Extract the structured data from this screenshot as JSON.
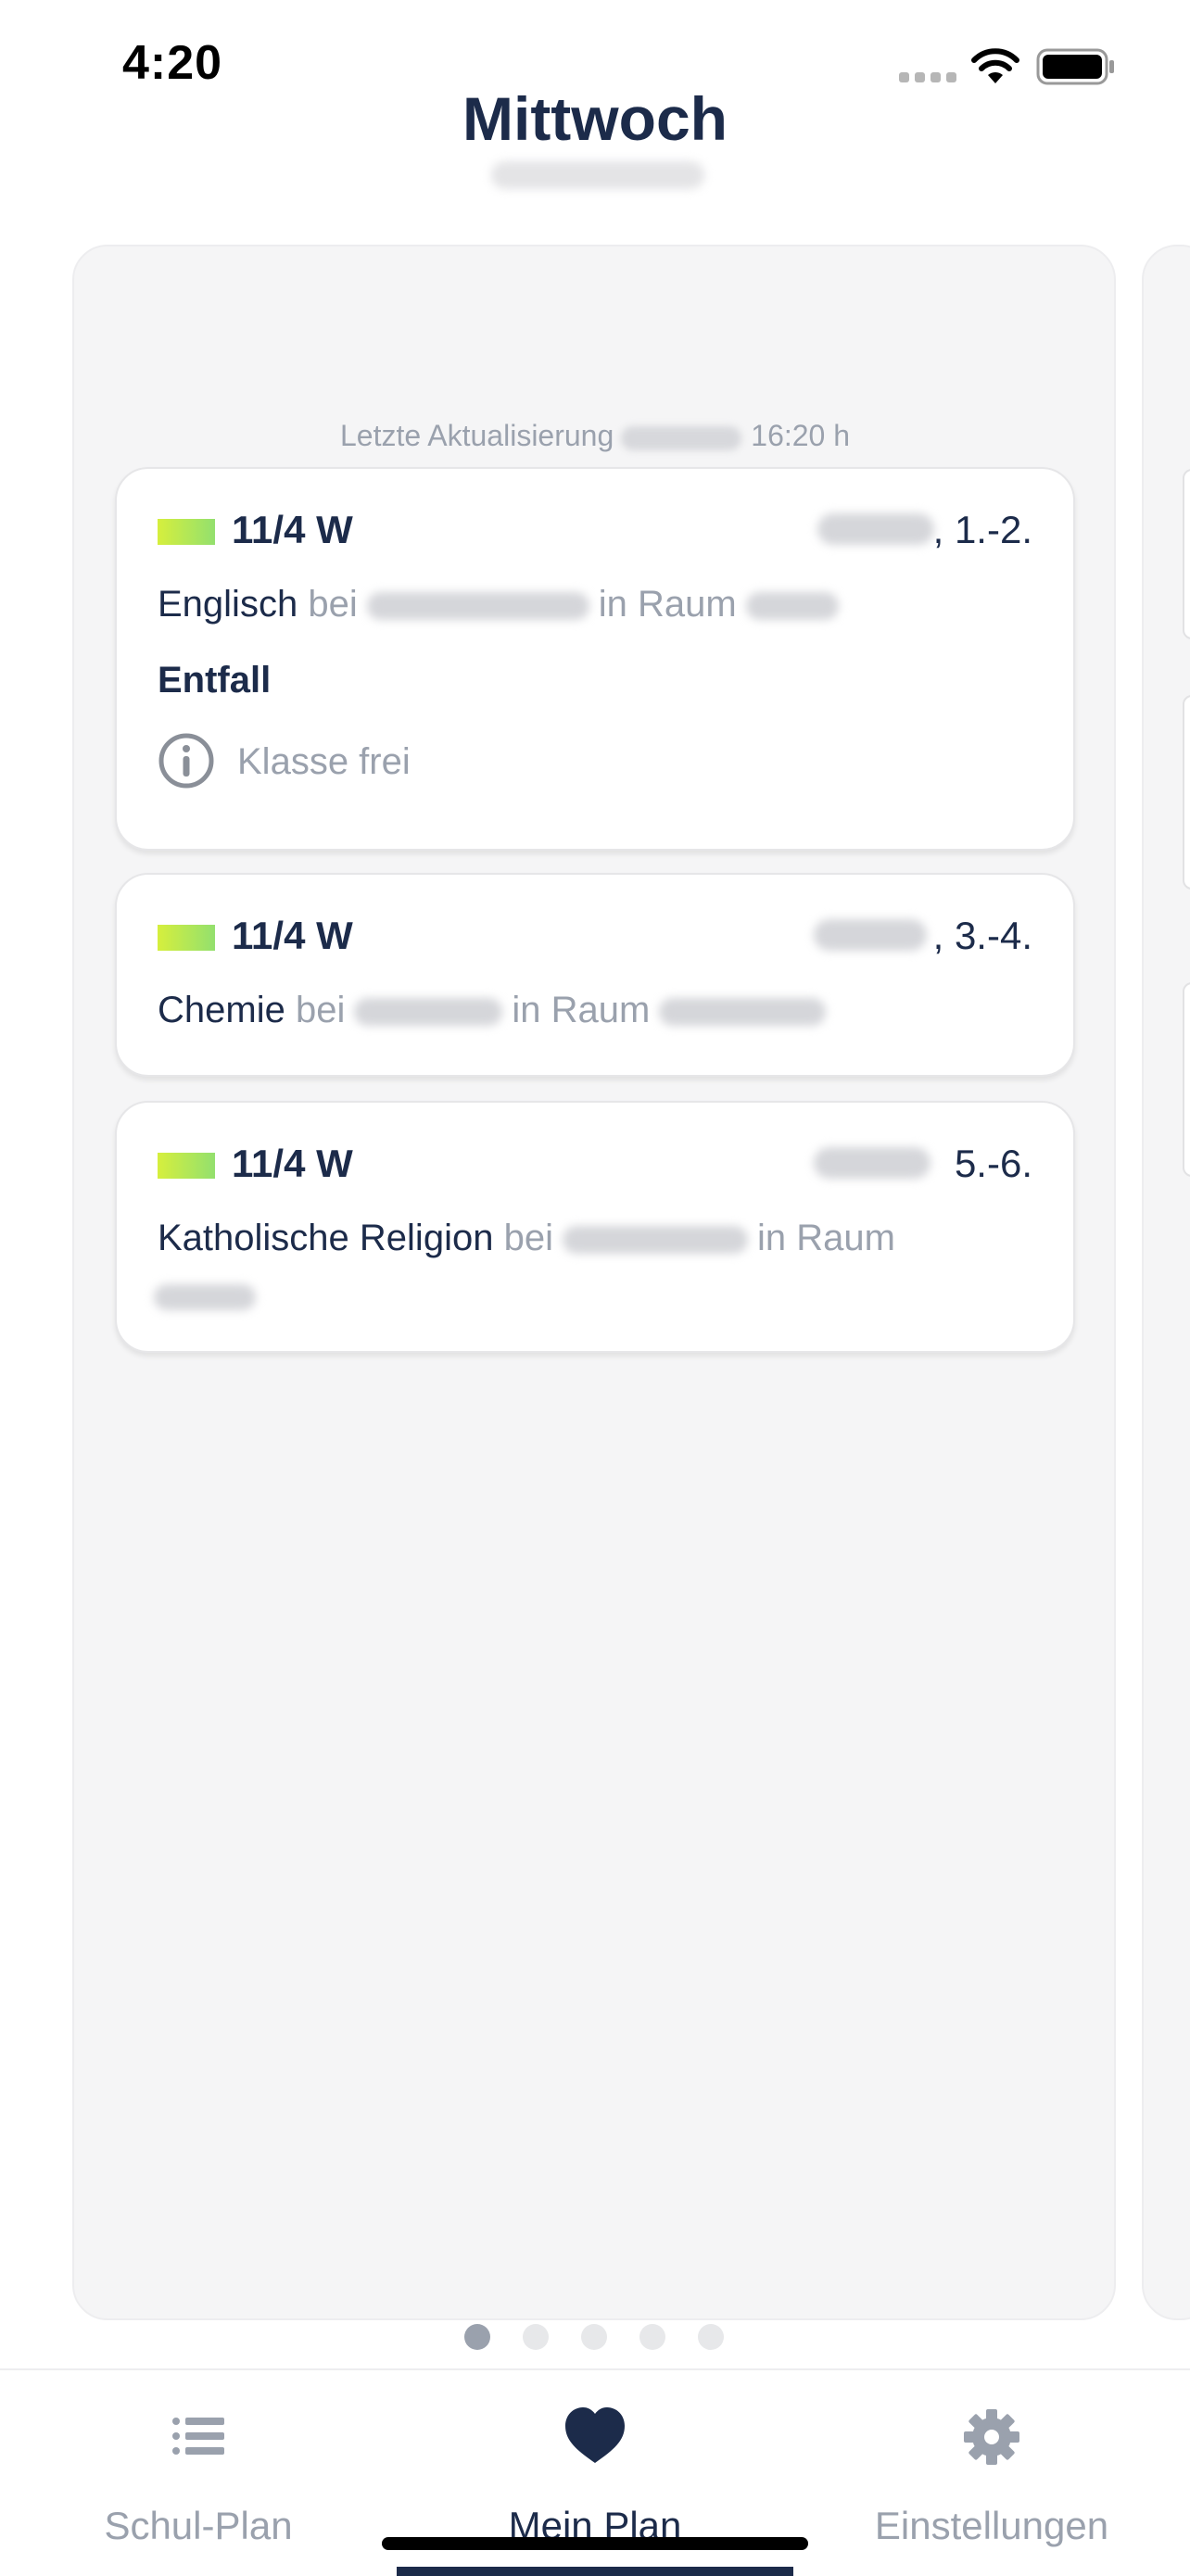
{
  "status_bar": {
    "time": "4:20"
  },
  "header": {
    "title": "Mittwoch"
  },
  "last_update": {
    "label": "Letzte Aktualisierung",
    "time": "16:20 h"
  },
  "lessons": [
    {
      "class": "11/4 W",
      "period": ", 1.-2.",
      "subject": "Englisch",
      "teacher_prefix": "bei",
      "room_prefix": "in Raum",
      "status": "Entfall",
      "info": "Klasse frei",
      "class_color": "#b9e85a"
    },
    {
      "class": "11/4 W",
      "period": ", 3.-4.",
      "subject": "Chemie",
      "teacher_prefix": "bei",
      "room_prefix": "in Raum",
      "class_color": "#b9e85a"
    },
    {
      "class": "11/4 W",
      "period": "5.-6.",
      "subject": "Katholische Religion",
      "teacher_prefix": "bei",
      "room_prefix": "in Raum",
      "class_color": "#b9e85a"
    }
  ],
  "pager": {
    "pages": 5,
    "active": 1
  },
  "tabbar": {
    "tabs": [
      {
        "label": "Schul-Plan",
        "icon": "list-icon",
        "active": false
      },
      {
        "label": "Mein Plan",
        "icon": "heart-icon",
        "active": true
      },
      {
        "label": "Einstellungen",
        "icon": "gear-icon",
        "active": false
      }
    ]
  },
  "colors": {
    "primary": "#1c2b4a",
    "muted": "#9aa1ad",
    "panel": "#f5f5f6",
    "accent_swatch": "#b9e85a"
  }
}
